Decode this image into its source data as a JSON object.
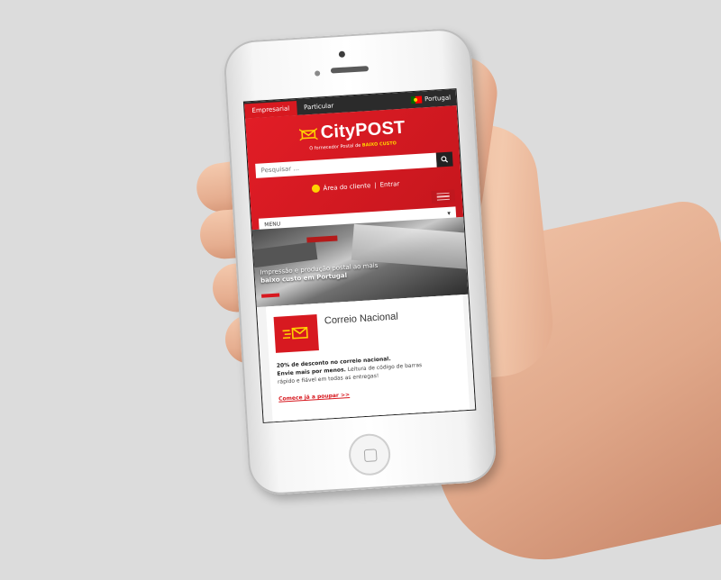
{
  "site": {
    "tabs": [
      "Empresarial",
      "Particular"
    ],
    "active_tab": "Empresarial",
    "country_label": "Portugal",
    "brand": "CityPOST",
    "tagline_prefix": "O fornecedor Postal de",
    "tagline_highlight": "BAIXO CUSTO",
    "search_placeholder": "Pesquisar ...",
    "client_area_label": "Área do cliente",
    "separator": "|",
    "login_label": "Entrar",
    "menu_label": "MENU",
    "hero": {
      "line1": "Impressão e produção postal ao mais",
      "line2": "baixo custo em Portugal"
    },
    "card": {
      "title": "Correio Nacional",
      "body_bold1": "20% de desconto no correio nacional.",
      "body_bold2": "Envie mais por menos.",
      "body_rest": "Leitura de código de barras rápido e fiável em todas as entregas!",
      "link": "Comece já a poupar >>"
    }
  },
  "colors": {
    "brand_red": "#d71920",
    "topbar_dark": "#2b2b2b",
    "accent_yellow": "#ffd200"
  }
}
